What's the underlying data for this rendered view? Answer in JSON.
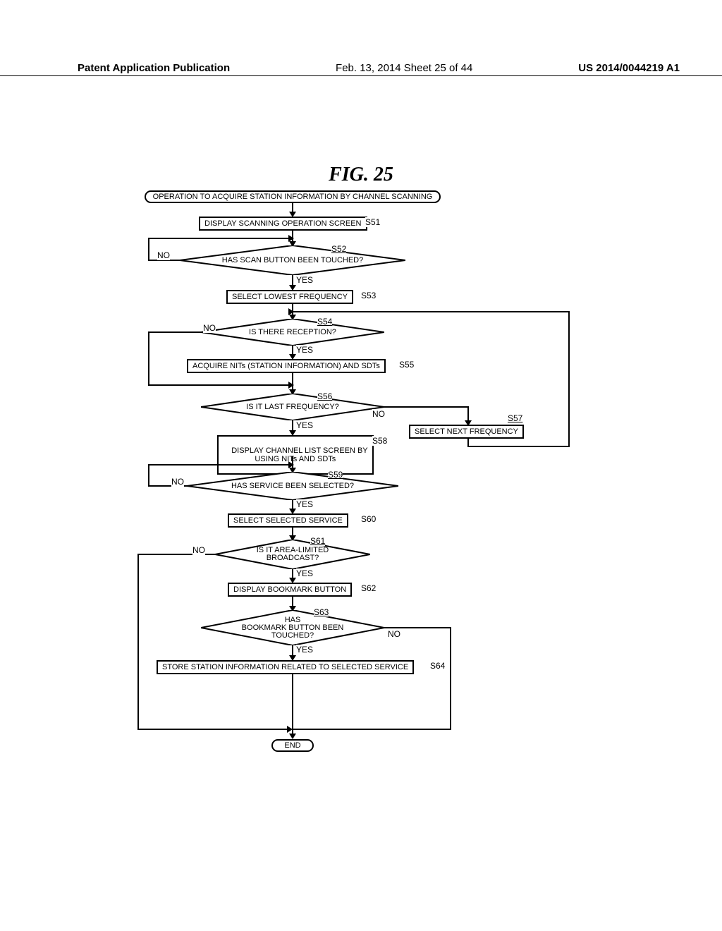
{
  "header": {
    "left": "Patent Application Publication",
    "mid": "Feb. 13, 2014  Sheet 25 of 44",
    "right": "US 2014/0044219 A1"
  },
  "figure_title": "FIG. 25",
  "steps": {
    "start": "OPERATION TO ACQUIRE STATION INFORMATION BY CHANNEL SCANNING",
    "s51": "DISPLAY SCANNING OPERATION SCREEN",
    "s52": "HAS SCAN BUTTON BEEN TOUCHED?",
    "s53": "SELECT LOWEST FREQUENCY",
    "s54": "IS THERE RECEPTION?",
    "s55": "ACQUIRE NITs (STATION INFORMATION) AND SDTs",
    "s56": "IS IT LAST FREQUENCY?",
    "s57": "SELECT NEXT FREQUENCY",
    "s58": "DISPLAY CHANNEL LIST SCREEN BY\nUSING NITs AND SDTs",
    "s59": "HAS SERVICE BEEN SELECTED?",
    "s60": "SELECT SELECTED SERVICE",
    "s61": "IS IT AREA-LIMITED\nBROADCAST?",
    "s62": "DISPLAY BOOKMARK BUTTON",
    "s63": "HAS\nBOOKMARK BUTTON BEEN\nTOUCHED?",
    "s64": "STORE STATION INFORMATION RELATED TO SELECTED SERVICE",
    "end": "END"
  },
  "labels": {
    "s51": "S51",
    "s52": "S52",
    "s53": "S53",
    "s54": "S54",
    "s55": "S55",
    "s56": "S56",
    "s57": "S57",
    "s58": "S58",
    "s59": "S59",
    "s60": "S60",
    "s61": "S61",
    "s62": "S62",
    "s63": "S63",
    "s64": "S64",
    "yes": "YES",
    "no": "NO"
  },
  "chart_data": {
    "type": "flowchart",
    "nodes": [
      {
        "id": "start",
        "type": "terminal",
        "text": "OPERATION TO ACQUIRE STATION INFORMATION BY CHANNEL SCANNING"
      },
      {
        "id": "S51",
        "type": "process",
        "text": "DISPLAY SCANNING OPERATION SCREEN"
      },
      {
        "id": "S52",
        "type": "decision",
        "text": "HAS SCAN BUTTON BEEN TOUCHED?"
      },
      {
        "id": "S53",
        "type": "process",
        "text": "SELECT LOWEST FREQUENCY"
      },
      {
        "id": "S54",
        "type": "decision",
        "text": "IS THERE RECEPTION?"
      },
      {
        "id": "S55",
        "type": "process",
        "text": "ACQUIRE NITs (STATION INFORMATION) AND SDTs"
      },
      {
        "id": "S56",
        "type": "decision",
        "text": "IS IT LAST FREQUENCY?"
      },
      {
        "id": "S57",
        "type": "process",
        "text": "SELECT NEXT FREQUENCY"
      },
      {
        "id": "S58",
        "type": "process",
        "text": "DISPLAY CHANNEL LIST SCREEN BY USING NITs AND SDTs"
      },
      {
        "id": "S59",
        "type": "decision",
        "text": "HAS SERVICE BEEN SELECTED?"
      },
      {
        "id": "S60",
        "type": "process",
        "text": "SELECT SELECTED SERVICE"
      },
      {
        "id": "S61",
        "type": "decision",
        "text": "IS IT AREA-LIMITED BROADCAST?"
      },
      {
        "id": "S62",
        "type": "process",
        "text": "DISPLAY BOOKMARK BUTTON"
      },
      {
        "id": "S63",
        "type": "decision",
        "text": "HAS BOOKMARK BUTTON BEEN TOUCHED?"
      },
      {
        "id": "S64",
        "type": "process",
        "text": "STORE STATION INFORMATION RELATED TO SELECTED SERVICE"
      },
      {
        "id": "end",
        "type": "terminal",
        "text": "END"
      }
    ],
    "edges": [
      {
        "from": "start",
        "to": "S51"
      },
      {
        "from": "S51",
        "to": "S52"
      },
      {
        "from": "S52",
        "to": "S53",
        "label": "YES"
      },
      {
        "from": "S52",
        "to": "S52",
        "label": "NO",
        "loop": true
      },
      {
        "from": "S53",
        "to": "S54"
      },
      {
        "from": "S54",
        "to": "S55",
        "label": "YES"
      },
      {
        "from": "S54",
        "to": "S56",
        "label": "NO"
      },
      {
        "from": "S55",
        "to": "S56"
      },
      {
        "from": "S56",
        "to": "S58",
        "label": "YES"
      },
      {
        "from": "S56",
        "to": "S57",
        "label": "NO"
      },
      {
        "from": "S57",
        "to": "S54"
      },
      {
        "from": "S58",
        "to": "S59"
      },
      {
        "from": "S59",
        "to": "S60",
        "label": "YES"
      },
      {
        "from": "S59",
        "to": "S59",
        "label": "NO",
        "loop": true
      },
      {
        "from": "S60",
        "to": "S61"
      },
      {
        "from": "S61",
        "to": "S62",
        "label": "YES"
      },
      {
        "from": "S61",
        "to": "end",
        "label": "NO"
      },
      {
        "from": "S62",
        "to": "S63"
      },
      {
        "from": "S63",
        "to": "S64",
        "label": "YES"
      },
      {
        "from": "S63",
        "to": "end",
        "label": "NO"
      },
      {
        "from": "S64",
        "to": "end"
      }
    ]
  }
}
